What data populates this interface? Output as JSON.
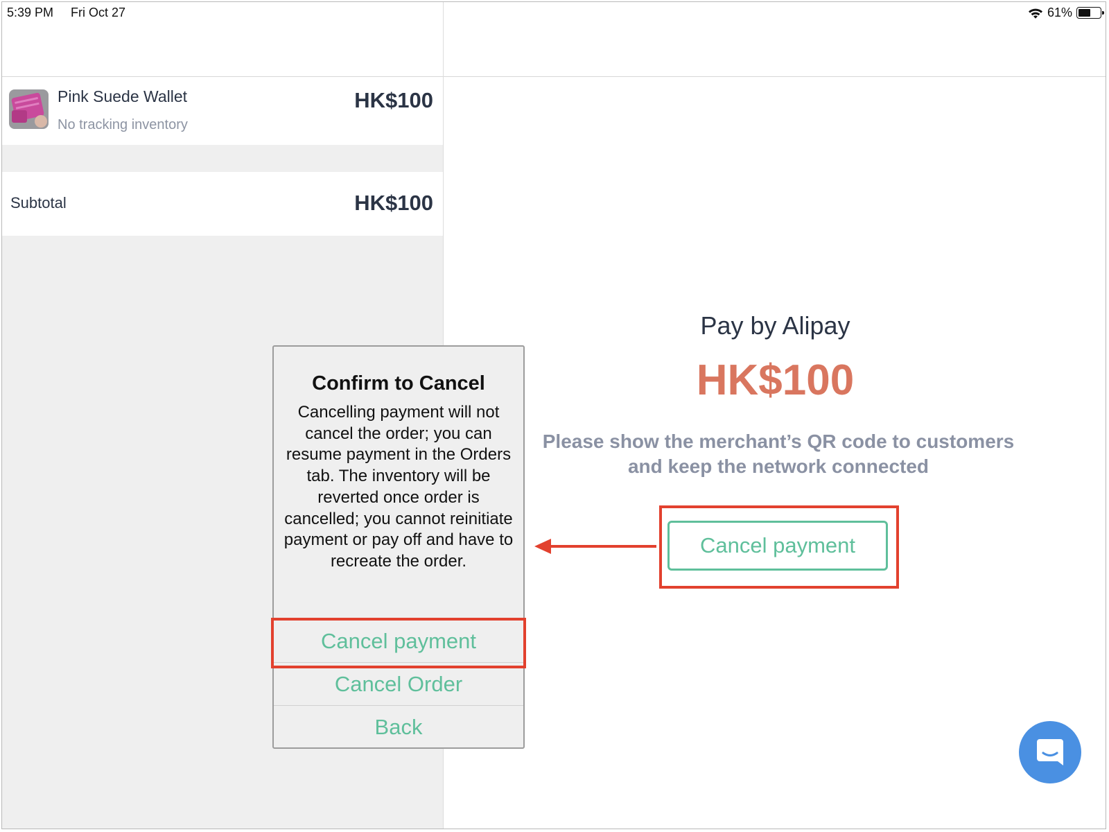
{
  "status_bar": {
    "time": "5:39 PM",
    "date": "Fri Oct 27",
    "battery": "61%",
    "battery_level": 0.61
  },
  "cart": {
    "item": {
      "name": "Pink Suede Wallet",
      "subtitle": "No tracking inventory",
      "price": "HK$100",
      "thumb_icon": "wallet-photo"
    },
    "subtotal_label": "Subtotal",
    "subtotal_value": "HK$100"
  },
  "payment": {
    "title": "Pay by Alipay",
    "amount": "HK$100",
    "instructions": "Please show the merchant’s QR code to customers and keep the network connected",
    "cancel_button": "Cancel payment"
  },
  "dialog": {
    "title": "Confirm to Cancel",
    "body": "Cancelling payment will not cancel the order; you can resume payment in the Orders tab. The inventory will be reverted once order is cancelled; you cannot reinitiate payment or pay off and have to recreate the order.",
    "buttons": [
      "Cancel payment",
      "Cancel Order",
      "Back"
    ]
  },
  "colors": {
    "accent_green": "#5fbf9b",
    "amount_orange": "#d9765f",
    "highlight_red": "#e2412e",
    "chat_blue": "#4a90e2"
  }
}
